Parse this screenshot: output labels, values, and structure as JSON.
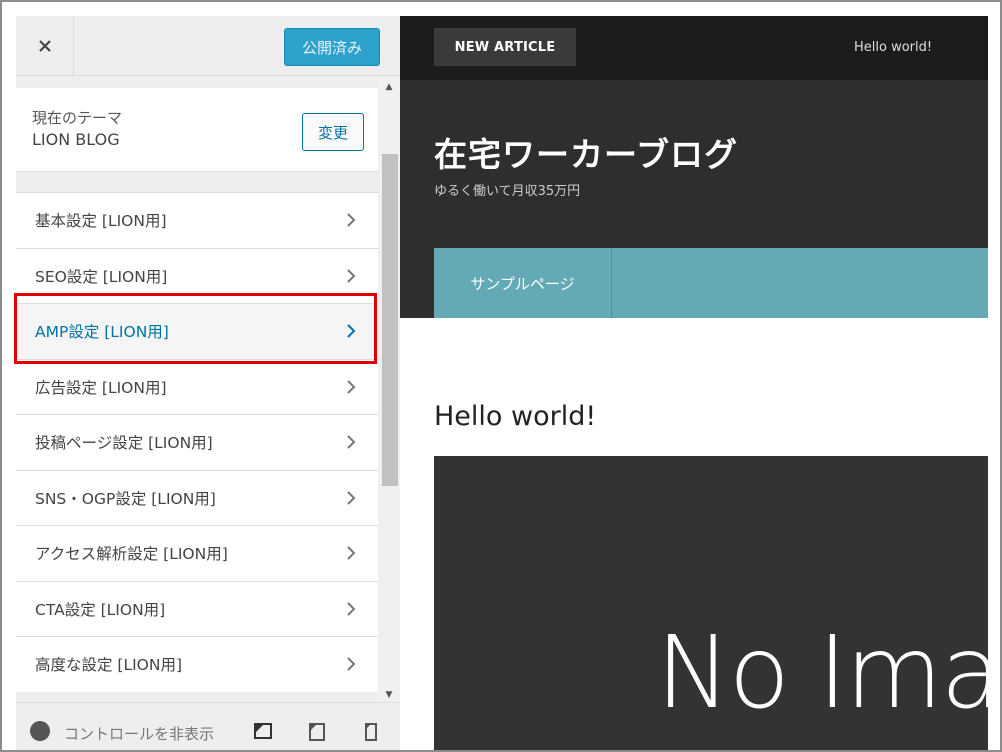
{
  "sidebar": {
    "close_icon": "close-icon",
    "publish_label": "公開済み",
    "theme_caption": "現在のテーマ",
    "theme_name": "LION BLOG",
    "change_label": "変更",
    "items": [
      {
        "label": "基本設定 [LION用]"
      },
      {
        "label": "SEO設定 [LION用]"
      },
      {
        "label": "AMP設定 [LION用]"
      },
      {
        "label": "広告設定 [LION用]"
      },
      {
        "label": "投稿ページ設定 [LION用]"
      },
      {
        "label": "SNS・OGP設定 [LION用]"
      },
      {
        "label": "アクセス解析設定 [LION用]"
      },
      {
        "label": "CTA設定 [LION用]"
      },
      {
        "label": "高度な設定 [LION用]"
      }
    ],
    "highlighted_item": "AMP設定 [LION用]",
    "highlight_color": "#e00000",
    "footer": {
      "collapse_label": "コントロールを非表示",
      "devices": [
        "desktop-icon",
        "tablet-icon",
        "mobile-icon"
      ]
    }
  },
  "preview": {
    "new_article": "NEW ARTICLE",
    "ticker": "Hello world!",
    "site_title": "在宅ワーカーブログ",
    "site_desc": "ゆるく働いて月収35万円",
    "nav": [
      "サンプルページ"
    ],
    "post_title": "Hello world!",
    "thumbnail_text": "No Imag",
    "colors": {
      "topbar": "#1c1c1c",
      "header": "#2e2e2e",
      "nav": "#63a9b6",
      "publish": "#2ea2cc",
      "link": "#0073aa"
    }
  }
}
